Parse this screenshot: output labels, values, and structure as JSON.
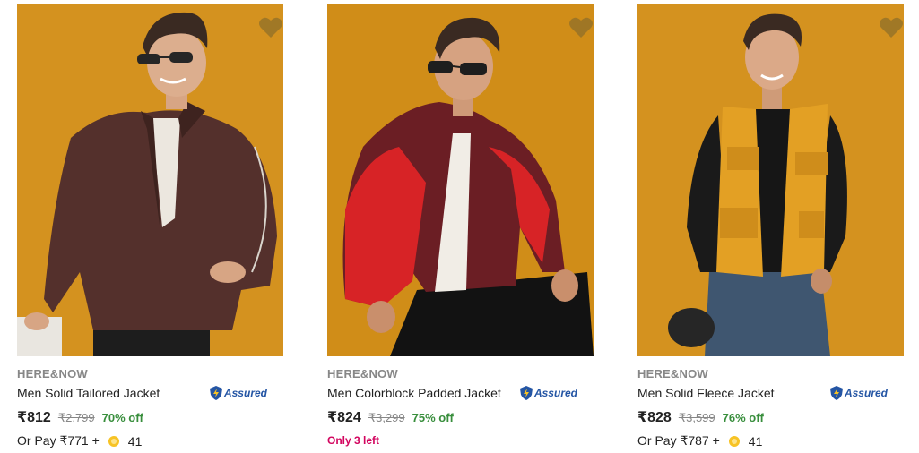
{
  "colors": {
    "background": "#ffffff",
    "photo_backdrop": "#d4921f",
    "brand_grey": "#878787",
    "discount_green": "#388e3c",
    "stock_pink": "#d2045e",
    "assured_blue": "#2455a4"
  },
  "products": [
    {
      "brand": "HERE&NOW",
      "title": "Men Solid Tailored Jacket",
      "assured_label": "Assured",
      "price": "₹812",
      "mrp": "₹2,799",
      "discount": "70% off",
      "pay_prefix": "Or Pay ₹771 +",
      "coins": "41",
      "wishlist_icon": "heart-icon"
    },
    {
      "brand": "HERE&NOW",
      "title": "Men Colorblock Padded Jacket",
      "assured_label": "Assured",
      "price": "₹824",
      "mrp": "₹3,299",
      "discount": "75% off",
      "stock_note": "Only 3 left",
      "wishlist_icon": "heart-icon"
    },
    {
      "brand": "HERE&NOW",
      "title": "Men Solid Fleece Jacket",
      "assured_label": "Assured",
      "price": "₹828",
      "mrp": "₹3,599",
      "discount": "76% off",
      "pay_prefix": "Or Pay ₹787 +",
      "coins": "41",
      "wishlist_icon": "heart-icon"
    }
  ]
}
